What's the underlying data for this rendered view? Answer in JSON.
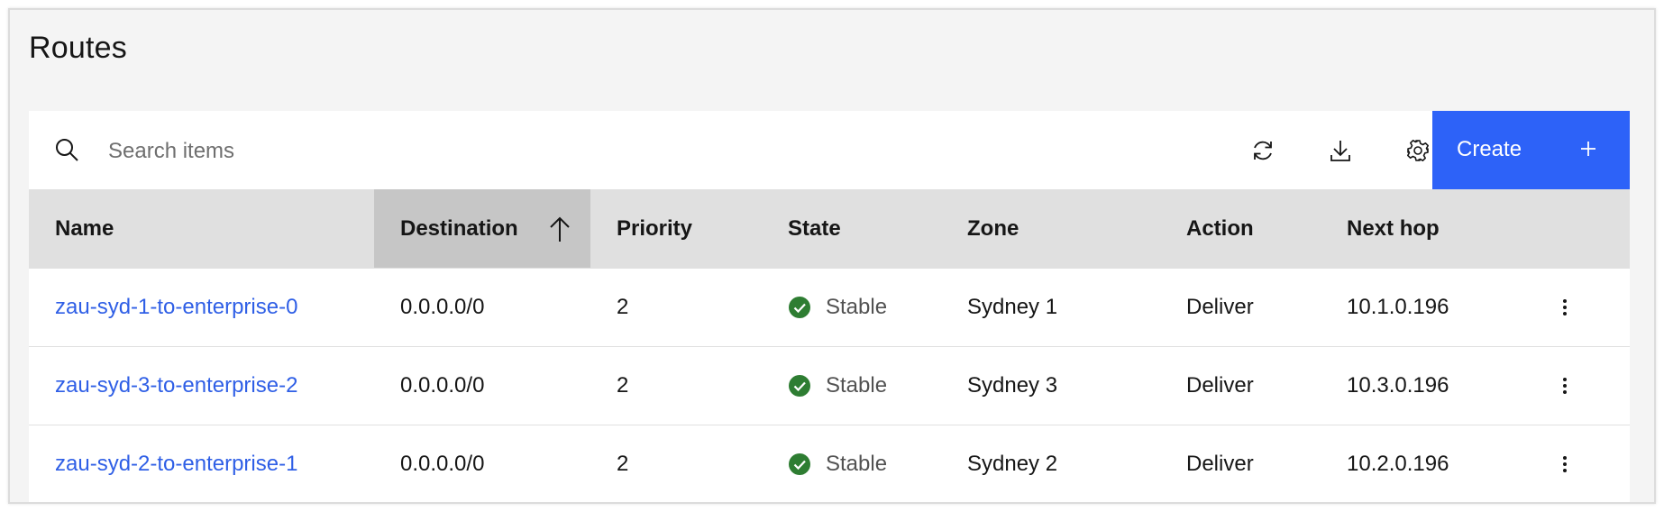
{
  "page": {
    "title": "Routes"
  },
  "toolbar": {
    "search_placeholder": "Search items",
    "refresh_icon": "refresh-icon",
    "download_icon": "download-icon",
    "settings_icon": "gear-icon",
    "create_label": "Create"
  },
  "colors": {
    "accent": "#2d62f8",
    "link": "#2f5fe6",
    "status_stable": "#2e7d32",
    "header_bg": "#e0e0e0",
    "sorted_header_bg": "#c6c6c6"
  },
  "table": {
    "columns": [
      "Name",
      "Destination",
      "Priority",
      "State",
      "Zone",
      "Action",
      "Next hop"
    ],
    "sorted_column": "Destination",
    "sort_direction": "ascending",
    "rows": [
      {
        "name": "zau-syd-1-to-enterprise-0",
        "destination": "0.0.0.0/0",
        "priority": "2",
        "state": "Stable",
        "zone": "Sydney 1",
        "action": "Deliver",
        "next_hop": "10.1.0.196"
      },
      {
        "name": "zau-syd-3-to-enterprise-2",
        "destination": "0.0.0.0/0",
        "priority": "2",
        "state": "Stable",
        "zone": "Sydney 3",
        "action": "Deliver",
        "next_hop": "10.3.0.196"
      },
      {
        "name": "zau-syd-2-to-enterprise-1",
        "destination": "0.0.0.0/0",
        "priority": "2",
        "state": "Stable",
        "zone": "Sydney 2",
        "action": "Deliver",
        "next_hop": "10.2.0.196"
      }
    ]
  }
}
